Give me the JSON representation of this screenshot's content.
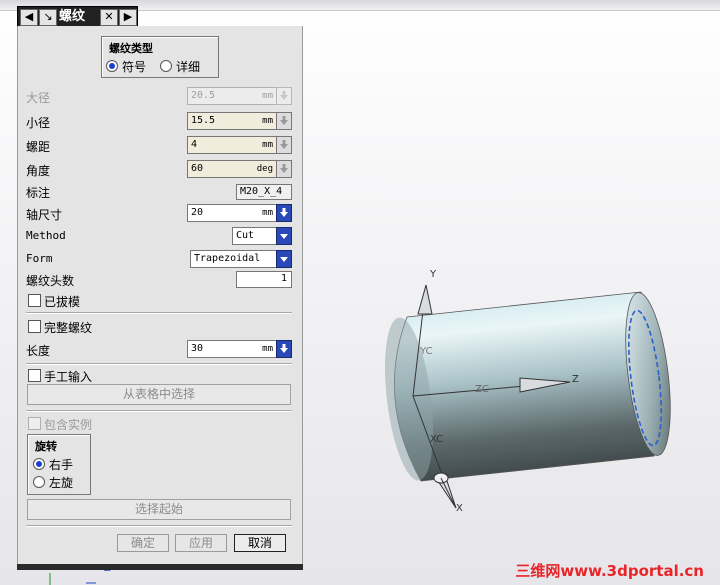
{
  "dialog": {
    "title": "螺纹",
    "title_buttons": {
      "back": "◀",
      "pin": "↘",
      "close": "✕",
      "forward": "▶"
    },
    "thread_type": {
      "title": "螺纹类型",
      "options": [
        "符号",
        "详细"
      ],
      "selected": "符号"
    },
    "fields": {
      "major_diameter": {
        "label": "大径",
        "value": "20.5",
        "unit": "mm",
        "enabled": false
      },
      "minor_diameter": {
        "label": "小径",
        "value": "15.5",
        "unit": "mm"
      },
      "pitch": {
        "label": "螺距",
        "value": "4",
        "unit": "mm"
      },
      "angle": {
        "label": "角度",
        "value": "60",
        "unit": "deg"
      },
      "callout": {
        "label": "标注",
        "value": "M20_X_4"
      },
      "shaft_size": {
        "label": "轴尺寸",
        "value": "20",
        "unit": "mm"
      },
      "method": {
        "label": "Method",
        "value": "Cut"
      },
      "form": {
        "label": "Form",
        "value": "Trapezoidal"
      },
      "num_starts": {
        "label": "螺纹头数",
        "value": "1"
      },
      "length": {
        "label": "长度",
        "value": "30",
        "unit": "mm"
      }
    },
    "checkboxes": {
      "tapered": {
        "label": "已拔模",
        "checked": false
      },
      "full_thread": {
        "label": "完整螺纹",
        "checked": false
      },
      "manual_input": {
        "label": "手工输入",
        "checked": false
      },
      "include_instances": {
        "label": "包含实例",
        "checked": false,
        "enabled": false
      }
    },
    "choose_from_table": "从表格中选择",
    "rotation": {
      "title": "旋转",
      "options": [
        "右手",
        "左旋"
      ],
      "selected": "右手"
    },
    "select_start": "选择起始",
    "buttons": {
      "ok": "确定",
      "apply": "应用",
      "cancel": "取消"
    }
  },
  "viewport": {
    "axis_labels": {
      "y": "Y",
      "yc": "YC",
      "z": "Z",
      "zc": "ZC",
      "xc": "XC",
      "x": "X"
    },
    "triad_label": "Z",
    "watermark": "三维网www.3dportal.cn"
  },
  "colors": {
    "cylinder_light": "#c8e4ea",
    "cylinder_dark": "#3c4446",
    "thread_marker": "#2a5fd0",
    "accent_spin": "#2b48b8"
  }
}
